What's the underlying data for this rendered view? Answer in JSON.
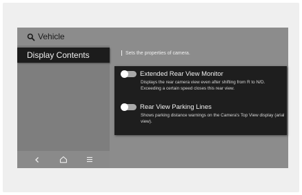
{
  "header": {
    "title": "Vehicle",
    "icon": "search-icon"
  },
  "sidebar": {
    "items": [
      {
        "label": "Display Contents",
        "selected": true
      }
    ]
  },
  "bottom_nav": {
    "items": [
      {
        "name": "back",
        "icon": "chevron-left-icon",
        "glyph": "<"
      },
      {
        "name": "home",
        "icon": "home-icon"
      },
      {
        "name": "menu",
        "icon": "menu-icon",
        "glyph": "≡"
      }
    ]
  },
  "content": {
    "subtitle": "Sets the properties of camera.",
    "settings": [
      {
        "label": "Extended Rear View Monitor",
        "description": "Displays the rear camera view even after shifting from R to N/D. Exceeding a certain speed closes this rear view.",
        "enabled": false
      },
      {
        "label": "Rear View Parking Lines",
        "description": "Shows parking distance warnings on the Camera's Top View display (arial view).",
        "enabled": false
      }
    ]
  }
}
